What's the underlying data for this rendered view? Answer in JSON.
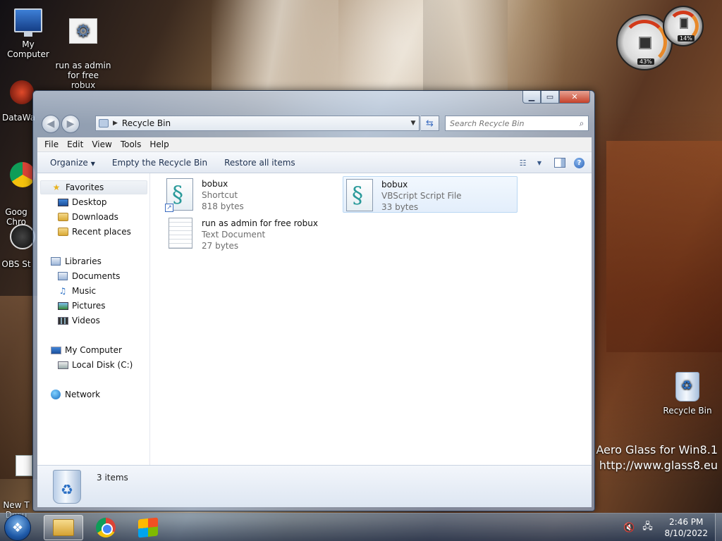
{
  "desktop": {
    "icons": [
      {
        "label": "My Computer"
      },
      {
        "label": "run as admin\nfor free robux"
      },
      {
        "label": "DataWa"
      },
      {
        "label": "Goog\nChro"
      },
      {
        "label": "OBS St"
      },
      {
        "label": "New T\nDocu"
      },
      {
        "label": "Recycle Bin"
      }
    ],
    "watermark_line1": "Aero Glass for Win8.1",
    "watermark_line2": "http://www.glass8.eu"
  },
  "gadget": {
    "cpu_percent": "43%",
    "mem_percent": "14%"
  },
  "window": {
    "address_path": "Recycle Bin",
    "search_placeholder": "Search Recycle Bin",
    "menu": [
      "File",
      "Edit",
      "View",
      "Tools",
      "Help"
    ],
    "commands": {
      "organize": "Organize",
      "empty": "Empty the Recycle Bin",
      "restore": "Restore all items"
    },
    "nav": {
      "favorites": "Favorites",
      "desktop": "Desktop",
      "downloads": "Downloads",
      "recent": "Recent places",
      "libraries": "Libraries",
      "documents": "Documents",
      "music": "Music",
      "pictures": "Pictures",
      "videos": "Videos",
      "computer": "My Computer",
      "local_disk": "Local Disk (C:)",
      "network": "Network"
    },
    "files": [
      {
        "name": "bobux",
        "type": "Shortcut",
        "size": "818 bytes"
      },
      {
        "name": "bobux",
        "type": "VBScript Script File",
        "size": "33 bytes"
      },
      {
        "name": "run as admin for free robux",
        "type": "Text Document",
        "size": "27 bytes"
      }
    ],
    "status_count": "3 items"
  },
  "taskbar": {
    "time": "2:46 PM",
    "date": "8/10/2022"
  }
}
